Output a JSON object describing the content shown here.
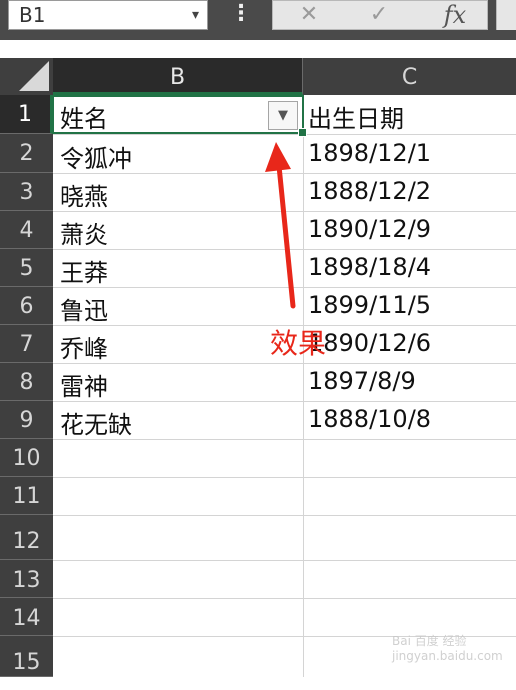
{
  "formula_bar": {
    "name_box": "B1",
    "name_box_arrow": "▾",
    "more_icon": "⋮",
    "cancel_icon": "✕",
    "enter_icon": "✓",
    "fx_label": "fx"
  },
  "columns": [
    {
      "label": "B",
      "active": true
    },
    {
      "label": "C",
      "active": false
    }
  ],
  "rows": [
    {
      "num": "1",
      "b": "姓名",
      "c": "出生日期"
    },
    {
      "num": "2",
      "b": "令狐冲",
      "c": "1898/12/1"
    },
    {
      "num": "3",
      "b": "晓燕",
      "c": "1888/12/2"
    },
    {
      "num": "4",
      "b": "萧炎",
      "c": "1890/12/9"
    },
    {
      "num": "5",
      "b": "王莽",
      "c": "1898/18/4"
    },
    {
      "num": "6",
      "b": "鲁迅",
      "c": "1899/11/5"
    },
    {
      "num": "7",
      "b": "乔峰",
      "c": "1890/12/6"
    },
    {
      "num": "8",
      "b": "雷神",
      "c": "1897/8/9"
    },
    {
      "num": "9",
      "b": "花无缺",
      "c": "1888/10/8"
    },
    {
      "num": "10",
      "b": "",
      "c": ""
    },
    {
      "num": "11",
      "b": "",
      "c": ""
    },
    {
      "num": "12",
      "b": "",
      "c": ""
    },
    {
      "num": "13",
      "b": "",
      "c": ""
    },
    {
      "num": "14",
      "b": "",
      "c": ""
    },
    {
      "num": "15",
      "b": "",
      "c": ""
    }
  ],
  "filter_icon": "▼",
  "annotation": "效果",
  "watermark": "Bai 百度 经验 jingyan.baidu.com",
  "colors": {
    "accent": "#217346",
    "annotation": "#e8271a",
    "header_bg": "#3f3f3f"
  }
}
